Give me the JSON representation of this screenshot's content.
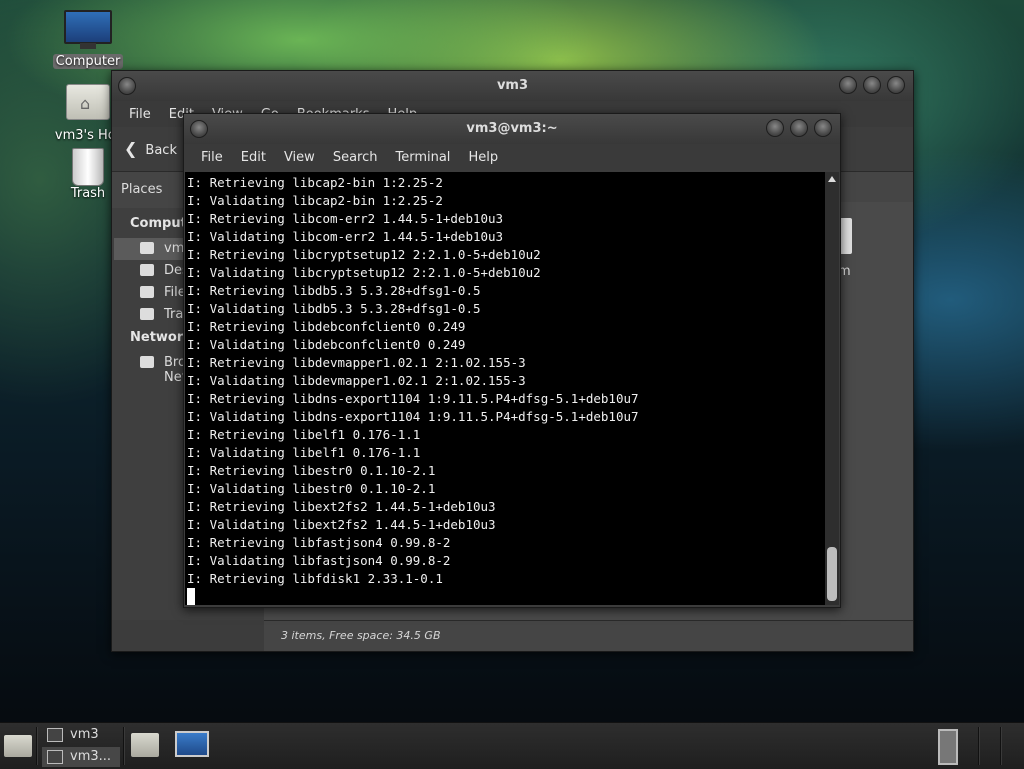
{
  "desktop": {
    "icons": [
      {
        "label": "Computer"
      },
      {
        "label": "vm3's Hor"
      },
      {
        "label": "Trash"
      }
    ]
  },
  "file_manager": {
    "title": "vm3",
    "menu": [
      "File",
      "Edit",
      "View",
      "Go",
      "Bookmarks",
      "Help"
    ],
    "back_label": "Back",
    "places_label": "Places",
    "sidebar": {
      "computer_header": "Computer",
      "items": [
        "vm3",
        "Desktop",
        "File System",
        "Trash"
      ],
      "network_header": "Network",
      "network_items": [
        "Browse Network"
      ]
    },
    "content_item": "File System",
    "content_item_visible": "em",
    "status": "3 items, Free space: 34.5 GB"
  },
  "terminal": {
    "title": "vm3@vm3:~",
    "menu": [
      "File",
      "Edit",
      "View",
      "Search",
      "Terminal",
      "Help"
    ],
    "lines": [
      "I: Retrieving libcap2-bin 1:2.25-2",
      "I: Validating libcap2-bin 1:2.25-2",
      "I: Retrieving libcom-err2 1.44.5-1+deb10u3",
      "I: Validating libcom-err2 1.44.5-1+deb10u3",
      "I: Retrieving libcryptsetup12 2:2.1.0-5+deb10u2",
      "I: Validating libcryptsetup12 2:2.1.0-5+deb10u2",
      "I: Retrieving libdb5.3 5.3.28+dfsg1-0.5",
      "I: Validating libdb5.3 5.3.28+dfsg1-0.5",
      "I: Retrieving libdebconfclient0 0.249",
      "I: Validating libdebconfclient0 0.249",
      "I: Retrieving libdevmapper1.02.1 2:1.02.155-3",
      "I: Validating libdevmapper1.02.1 2:1.02.155-3",
      "I: Retrieving libdns-export1104 1:9.11.5.P4+dfsg-5.1+deb10u7",
      "I: Validating libdns-export1104 1:9.11.5.P4+dfsg-5.1+deb10u7",
      "I: Retrieving libelf1 0.176-1.1",
      "I: Validating libelf1 0.176-1.1",
      "I: Retrieving libestr0 0.1.10-2.1",
      "I: Validating libestr0 0.1.10-2.1",
      "I: Retrieving libext2fs2 1.44.5-1+deb10u3",
      "I: Validating libext2fs2 1.44.5-1+deb10u3",
      "I: Retrieving libfastjson4 0.99.8-2",
      "I: Validating libfastjson4 0.99.8-2",
      "I: Retrieving libfdisk1 2.33.1-0.1"
    ]
  },
  "taskbar": {
    "tasks": [
      {
        "label": "vm3"
      },
      {
        "label": "vm3..."
      }
    ]
  }
}
